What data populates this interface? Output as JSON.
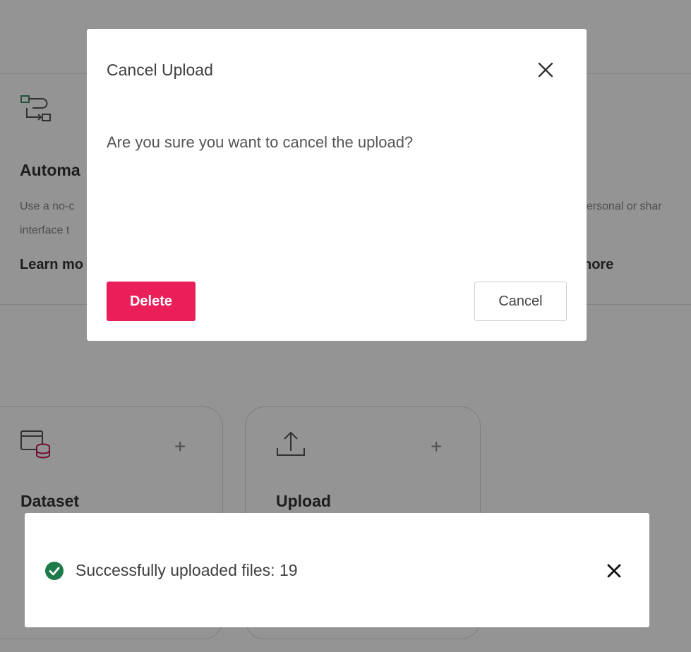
{
  "background": {
    "automation": {
      "title": "Automa",
      "description_left_1": "Use a no-c",
      "description_left_2": "interface t",
      "description_right": "personal or shar",
      "learn_more_left": "Learn mo",
      "learn_more_right": "nore"
    },
    "cards": [
      {
        "title": "Dataset",
        "icon": "dataset-icon",
        "action_icon": "plus-icon"
      },
      {
        "title": "Upload",
        "icon": "upload-icon",
        "action_icon": "plus-icon"
      }
    ]
  },
  "modal": {
    "title": "Cancel Upload",
    "message": "Are you sure you want to cancel the upload?",
    "delete_label": "Delete",
    "cancel_label": "Cancel",
    "close_icon": "close-icon"
  },
  "toast": {
    "message": "Successfully uploaded files: 19",
    "status_icon": "check-circle-icon",
    "close_icon": "close-icon"
  },
  "colors": {
    "danger": "#ea1f5a",
    "success": "#1d7a4a",
    "overlay": "rgba(0,0,0,0.42)"
  },
  "plus_glyph": "+"
}
